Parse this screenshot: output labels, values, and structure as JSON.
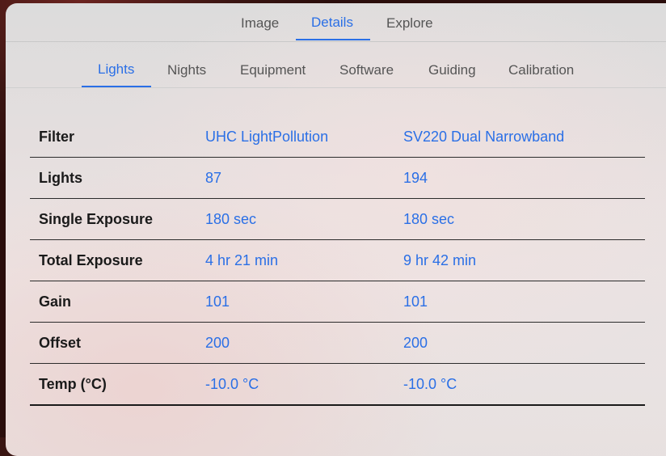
{
  "top_tabs": [
    {
      "label": "Image",
      "active": false
    },
    {
      "label": "Details",
      "active": true
    },
    {
      "label": "Explore",
      "active": false
    }
  ],
  "sub_tabs": [
    {
      "label": "Lights",
      "active": true
    },
    {
      "label": "Nights",
      "active": false
    },
    {
      "label": "Equipment",
      "active": false
    },
    {
      "label": "Software",
      "active": false
    },
    {
      "label": "Guiding",
      "active": false
    },
    {
      "label": "Calibration",
      "active": false
    }
  ],
  "table": {
    "rows": [
      {
        "label": "Filter",
        "values": [
          "UHC LightPollution",
          "SV220 Dual Narrowband"
        ]
      },
      {
        "label": "Lights",
        "values": [
          "87",
          "194"
        ]
      },
      {
        "label": "Single Exposure",
        "values": [
          "180 sec",
          "180 sec"
        ]
      },
      {
        "label": "Total Exposure",
        "values": [
          "4 hr 21 min",
          "9 hr 42 min"
        ]
      },
      {
        "label": "Gain",
        "values": [
          "101",
          "101"
        ]
      },
      {
        "label": "Offset",
        "values": [
          "200",
          "200"
        ]
      },
      {
        "label": "Temp (°C)",
        "values": [
          "-10.0 °C",
          "-10.0 °C"
        ]
      }
    ]
  },
  "colors": {
    "accent": "#2a6fe6",
    "text": "#1a1a1a",
    "tab_inactive": "#555555"
  }
}
